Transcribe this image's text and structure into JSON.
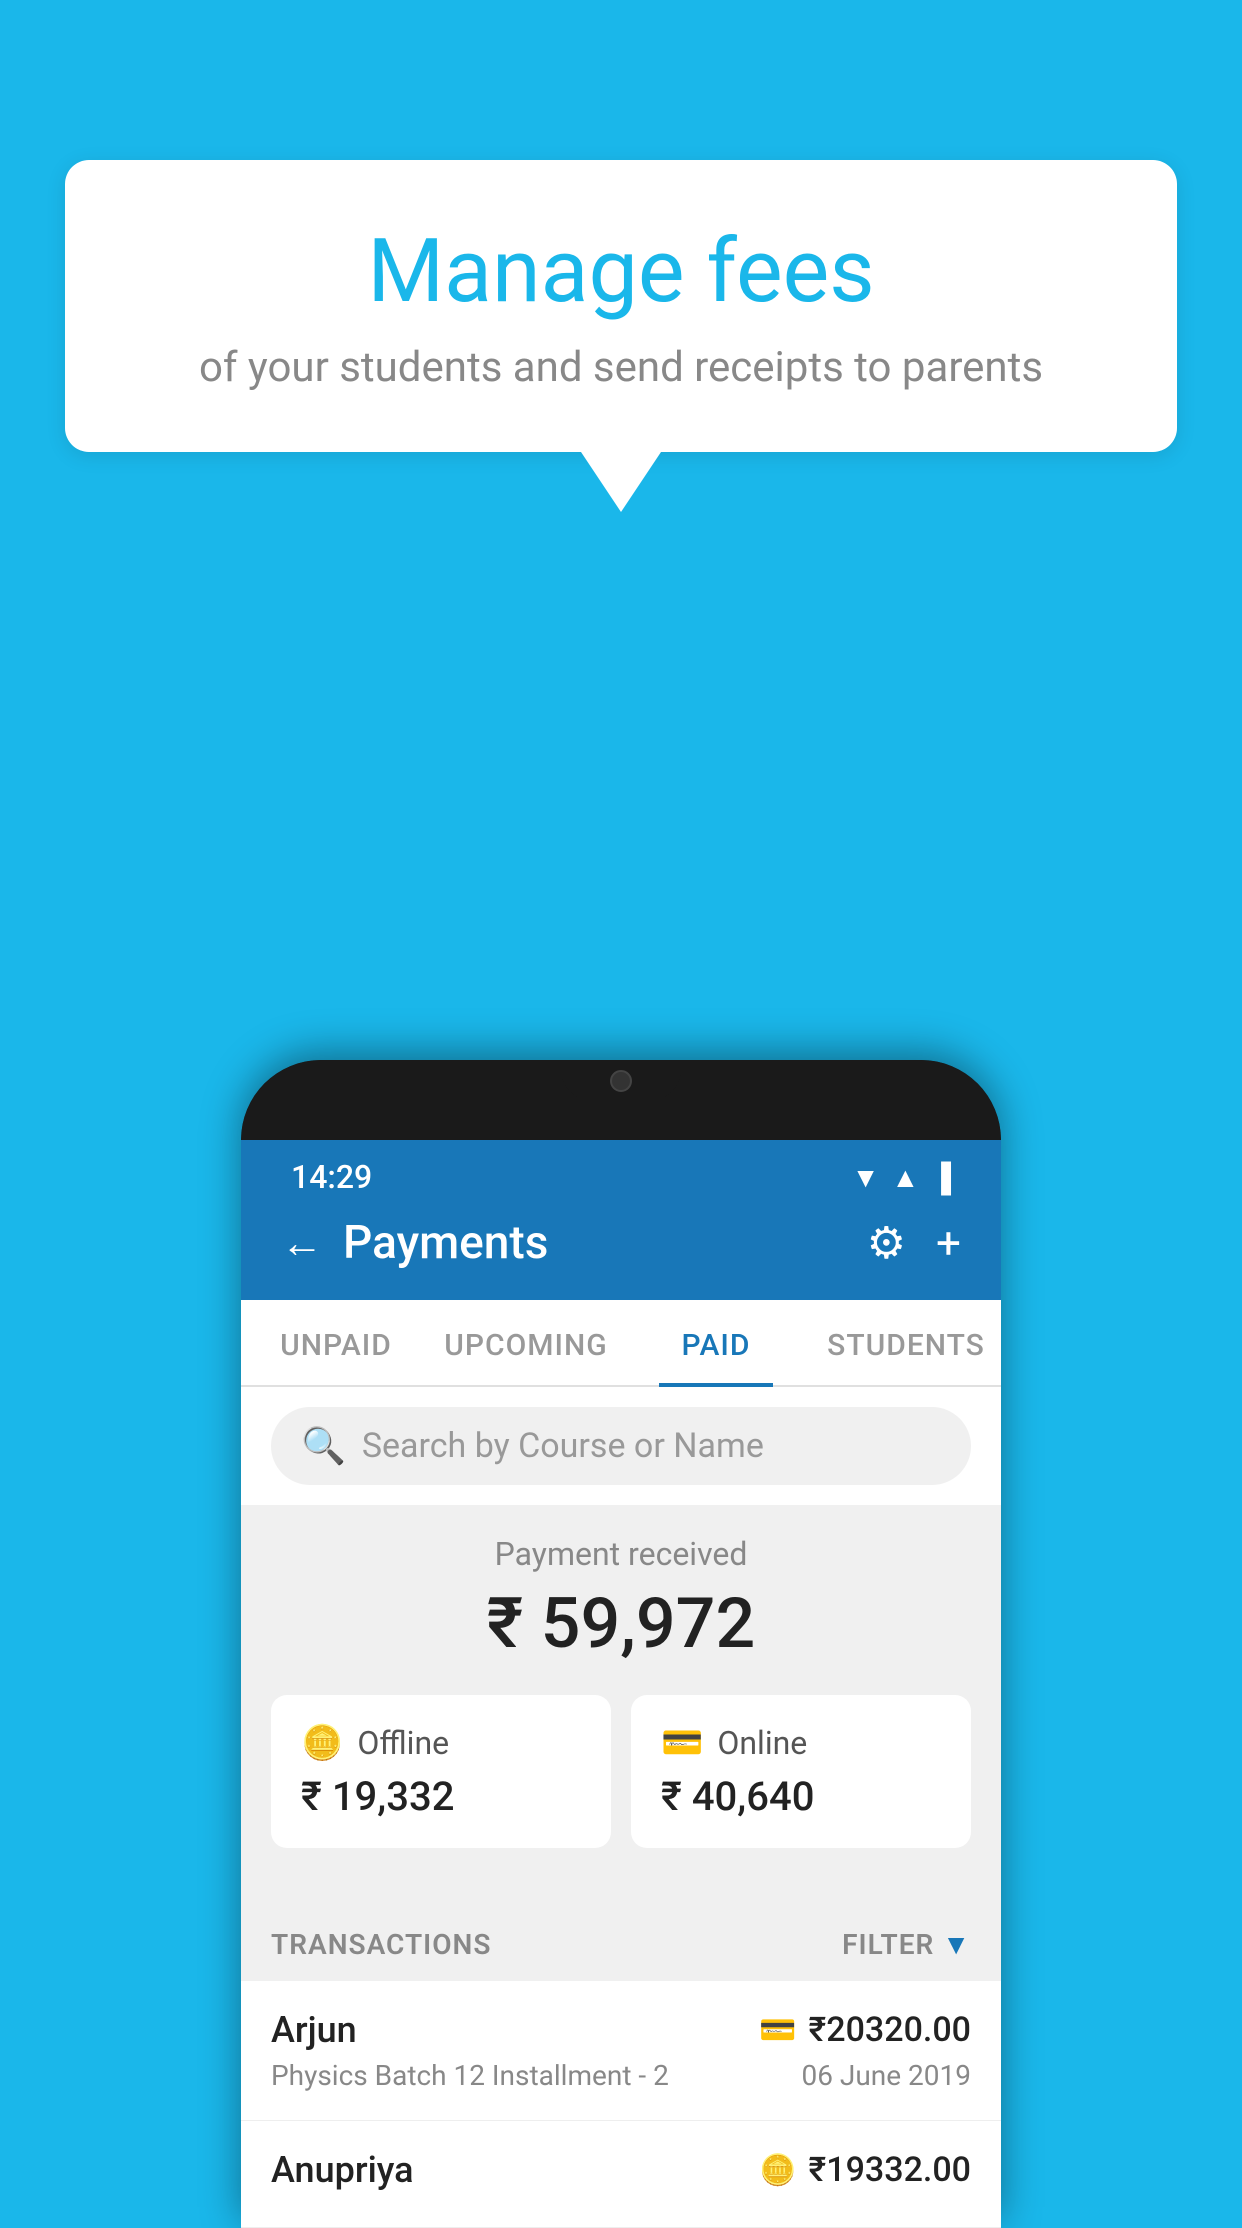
{
  "background_color": "#1ab7ea",
  "speech_bubble": {
    "title": "Manage fees",
    "subtitle": "of your students and send receipts to parents"
  },
  "status_bar": {
    "time": "14:29",
    "icons": [
      "wifi",
      "signal",
      "battery"
    ]
  },
  "header": {
    "title": "Payments",
    "back_label": "←",
    "settings_label": "⚙",
    "add_label": "+"
  },
  "tabs": [
    {
      "label": "UNPAID",
      "active": false
    },
    {
      "label": "UPCOMING",
      "active": false
    },
    {
      "label": "PAID",
      "active": true
    },
    {
      "label": "STUDENTS",
      "active": false
    }
  ],
  "search": {
    "placeholder": "Search by Course or Name"
  },
  "payment_section": {
    "label": "Payment received",
    "amount": "₹ 59,972",
    "offline_label": "Offline",
    "offline_amount": "₹ 19,332",
    "online_label": "Online",
    "online_amount": "₹ 40,640"
  },
  "transactions": {
    "header_label": "TRANSACTIONS",
    "filter_label": "FILTER",
    "rows": [
      {
        "name": "Arjun",
        "amount": "₹20320.00",
        "course": "Physics Batch 12 Installment - 2",
        "date": "06 June 2019",
        "icon_type": "card"
      },
      {
        "name": "Anupriya",
        "amount": "₹19332.00",
        "course": "",
        "date": "",
        "icon_type": "cash"
      }
    ]
  }
}
